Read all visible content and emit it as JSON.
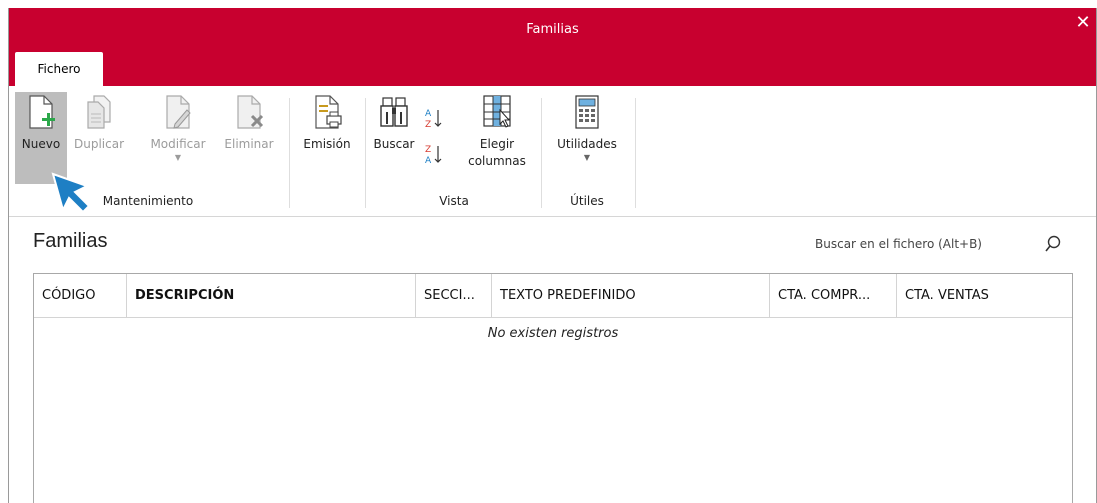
{
  "window": {
    "title": "Familias",
    "close_label": "✕"
  },
  "tabs": [
    {
      "label": "Fichero"
    }
  ],
  "ribbon": {
    "buttons": {
      "nuevo": "Nuevo",
      "duplicar": "Duplicar",
      "modificar": "Modificar",
      "eliminar": "Eliminar",
      "emision": "Emisión",
      "buscar": "Buscar",
      "elegir_line1": "Elegir",
      "elegir_line2": "columnas",
      "utilidades": "Utilidades"
    },
    "groups": {
      "mantenimiento": "Mantenimiento",
      "vista": "Vista",
      "utiles": "Útiles"
    }
  },
  "main": {
    "title": "Familias",
    "search_placeholder": "Buscar en el fichero (Alt+B)",
    "table": {
      "columns": [
        "CÓDIGO",
        "DESCRIPCIÓN",
        "SECCI...",
        "TEXTO PREDEFINIDO",
        "CTA. COMPR...",
        "CTA. VENTAS"
      ],
      "empty_message": "No existen registros"
    }
  },
  "colors": {
    "accent": "#c8002f",
    "selected_bg": "#bdbdbd",
    "cursor": "#1e7fc4"
  },
  "icons": [
    "new-document-icon",
    "duplicate-icon",
    "edit-icon",
    "delete-icon",
    "print-icon",
    "binoculars-icon",
    "sort-asc-icon",
    "sort-desc-icon",
    "columns-icon",
    "calculator-icon",
    "search-icon",
    "mouse-cursor-icon"
  ]
}
